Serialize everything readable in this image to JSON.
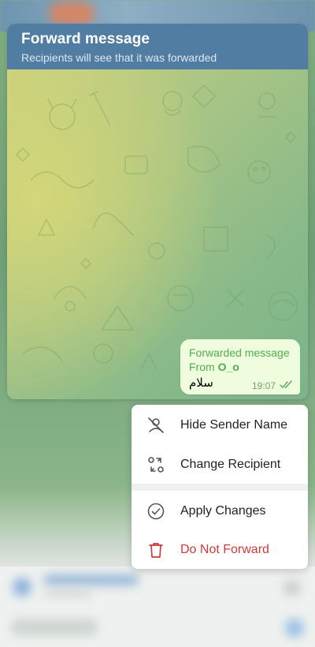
{
  "header": {
    "title": "Forward message",
    "subtitle": "Recipients will see that it was forwarded"
  },
  "message": {
    "forwarded_label": "Forwarded message",
    "from_prefix": "From",
    "from_name": "O_o",
    "text": "سلام",
    "time": "19:07",
    "status_icon": "double-check-icon"
  },
  "menu": {
    "items": [
      {
        "label": "Hide Sender Name",
        "icon": "hide-sender-icon"
      },
      {
        "label": "Change Recipient",
        "icon": "change-recipient-icon"
      },
      {
        "label": "Apply Changes",
        "icon": "check-circle-icon"
      },
      {
        "label": "Do Not Forward",
        "icon": "trash-icon"
      }
    ]
  },
  "colors": {
    "header_bg": "#517da2",
    "bubble_bg": "#effdde",
    "forward_green": "#4fae4e",
    "danger_red": "#cc3b3b"
  }
}
